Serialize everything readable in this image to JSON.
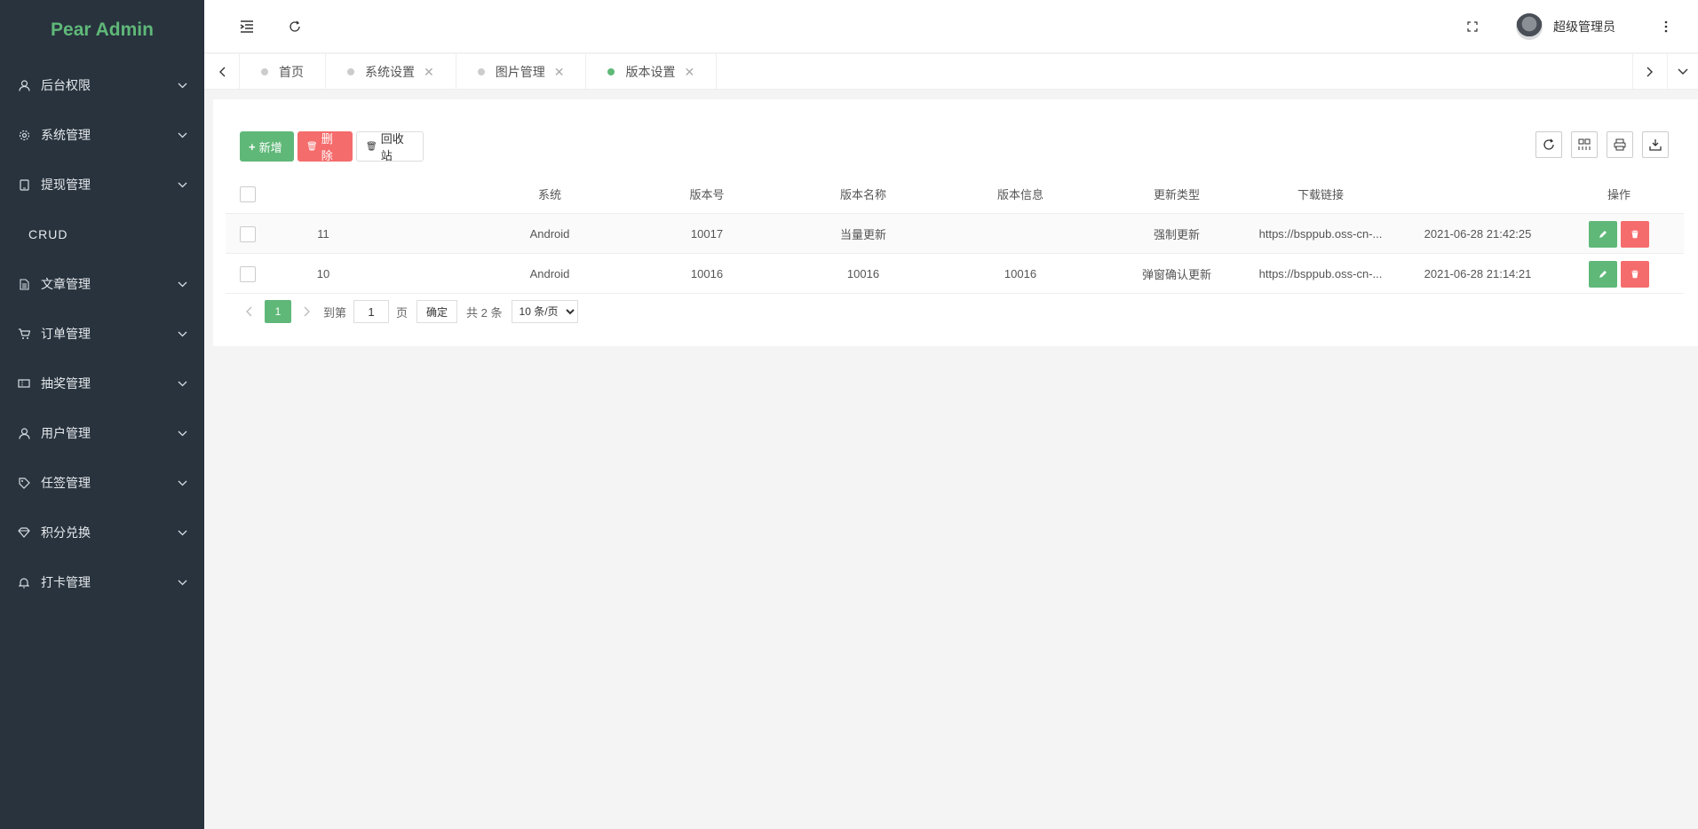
{
  "app": {
    "title": "Pear Admin"
  },
  "sidebar": {
    "items": [
      {
        "label": "后台权限",
        "icon": "user-icon",
        "arrow": true
      },
      {
        "label": "系统管理",
        "icon": "gear-icon",
        "arrow": true
      },
      {
        "label": "提现管理",
        "icon": "tablet-icon",
        "arrow": true
      },
      {
        "label": "CRUD",
        "icon": "",
        "arrow": false
      },
      {
        "label": "文章管理",
        "icon": "document-icon",
        "arrow": true
      },
      {
        "label": "订单管理",
        "icon": "cart-icon",
        "arrow": true
      },
      {
        "label": "抽奖管理",
        "icon": "ticket-icon",
        "arrow": true
      },
      {
        "label": "用户管理",
        "icon": "user-icon",
        "arrow": true
      },
      {
        "label": "任签管理",
        "icon": "tag-icon",
        "arrow": true
      },
      {
        "label": "积分兑换",
        "icon": "diamond-icon",
        "arrow": true
      },
      {
        "label": "打卡管理",
        "icon": "bell-icon",
        "arrow": true
      }
    ]
  },
  "header": {
    "user_name": "超级管理员"
  },
  "tabs": [
    {
      "label": "首页",
      "closable": false,
      "active": false
    },
    {
      "label": "系统设置",
      "closable": true,
      "active": false
    },
    {
      "label": "图片管理",
      "closable": true,
      "active": false
    },
    {
      "label": "版本设置",
      "closable": true,
      "active": true
    }
  ],
  "toolbar": {
    "add_label": "新增",
    "delete_label": "删除",
    "recycle_label": "回收站"
  },
  "table": {
    "columns": [
      "系统",
      "版本号",
      "版本名称",
      "版本信息",
      "更新类型",
      "下载链接",
      "操作"
    ],
    "rows": [
      {
        "id": "11",
        "system": "Android",
        "version_code": "10017",
        "version_name": "当量更新",
        "version_info": "",
        "update_type": "强制更新",
        "download_link": "https://bsppub.oss-cn-...",
        "time": "2021-06-28 21:42:25"
      },
      {
        "id": "10",
        "system": "Android",
        "version_code": "10016",
        "version_name": "10016",
        "version_info": "10016",
        "update_type": "弹窗确认更新",
        "download_link": "https://bsppub.oss-cn-...",
        "time": "2021-06-28 21:14:21"
      }
    ]
  },
  "pager": {
    "current_page": "1",
    "goto_label": "到第",
    "goto_value": "1",
    "page_label": "页",
    "confirm_label": "确定",
    "total_label": "共 2 条",
    "page_size_label": "10 条/页"
  },
  "colors": {
    "primary": "#5fb878",
    "danger": "#f56c6c",
    "sidebar_bg": "#28333e"
  }
}
